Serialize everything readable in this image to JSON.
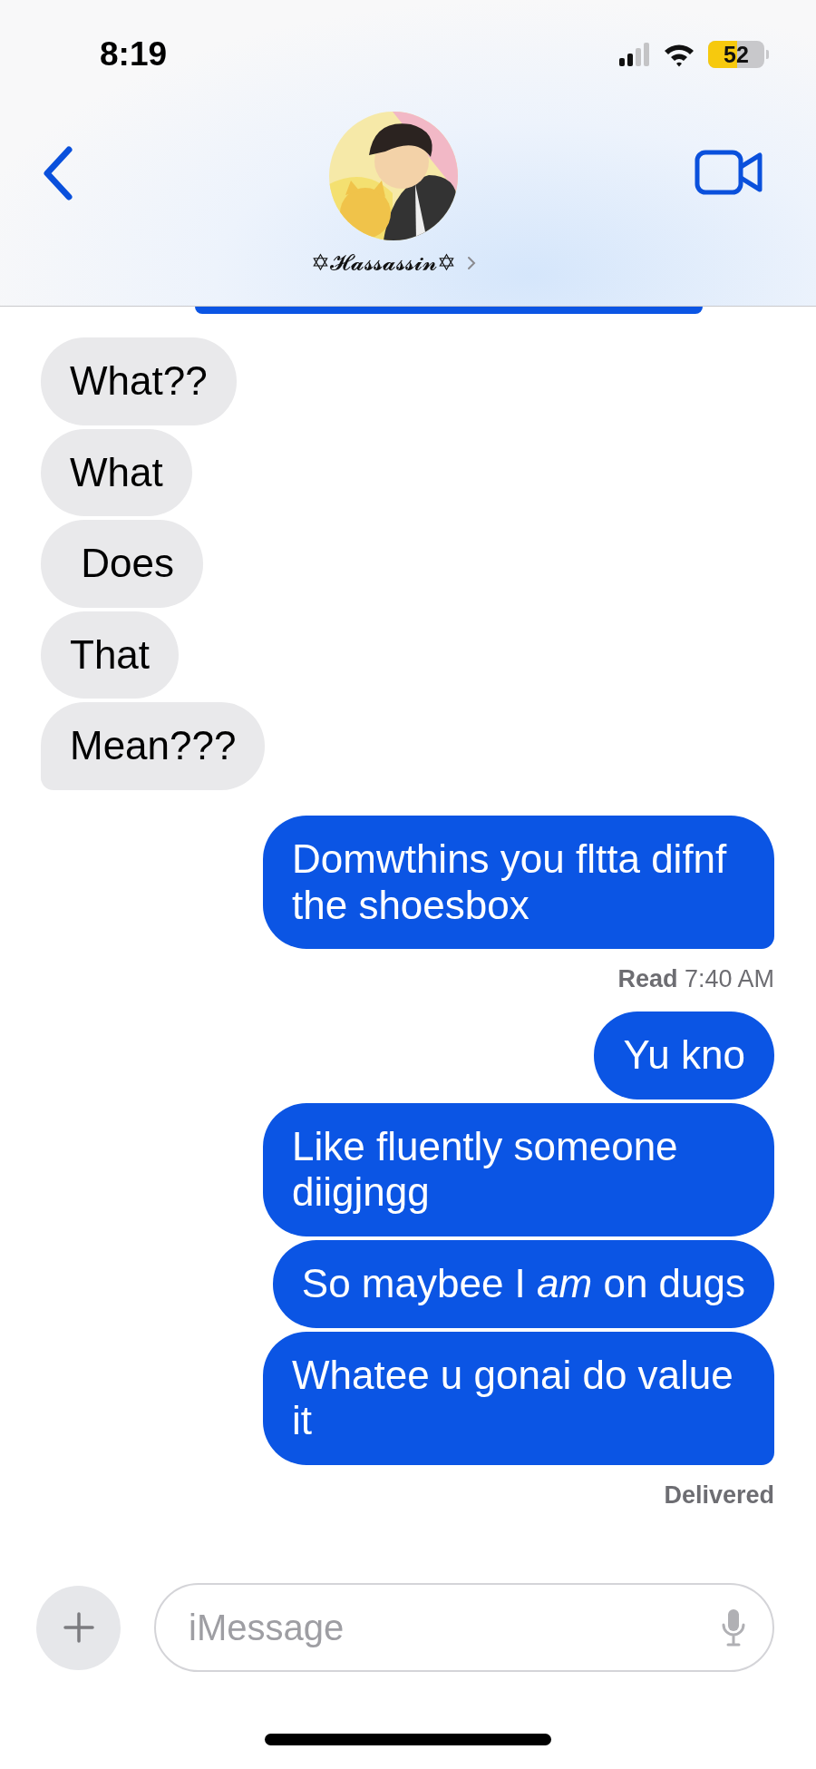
{
  "status_bar": {
    "time": "8:19",
    "battery": "52"
  },
  "header": {
    "contact_name": "✡𝓗𝓪𝓼𝓼𝓪𝓼𝓼𝓲𝓷✡"
  },
  "messages": [
    {
      "kind": "received",
      "text": "What??",
      "tail": false
    },
    {
      "kind": "received",
      "text": "What",
      "tail": false
    },
    {
      "kind": "received",
      "text": " Does",
      "tail": false
    },
    {
      "kind": "received",
      "text": "That",
      "tail": false
    },
    {
      "kind": "received",
      "text": "Mean???",
      "tail": true
    },
    {
      "kind": "sent",
      "text": "Domwthins you fltta difnf the shoesbox",
      "tail": true
    },
    {
      "kind": "receipt",
      "text": "**Read** 7:40 AM"
    },
    {
      "kind": "sent",
      "text": "Yu kno",
      "tail": false
    },
    {
      "kind": "sent",
      "text": "Like fluently someone diigjngg",
      "tail": false
    },
    {
      "kind": "sent",
      "text": "So maybee I *am* on dugs",
      "tail": false
    },
    {
      "kind": "sent",
      "text": "Whatee u gonai do value it",
      "tail": true
    },
    {
      "kind": "receipt",
      "text": "**Delivered**"
    }
  ],
  "composer": {
    "placeholder": "iMessage"
  }
}
